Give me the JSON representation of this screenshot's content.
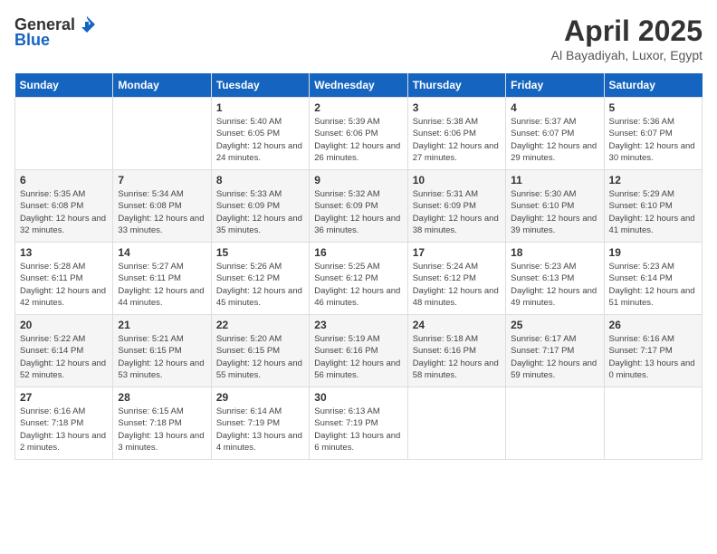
{
  "header": {
    "logo": {
      "line1": "General",
      "line2": "Blue"
    },
    "title": "April 2025",
    "subtitle": "Al Bayadiyah, Luxor, Egypt"
  },
  "days_of_week": [
    "Sunday",
    "Monday",
    "Tuesday",
    "Wednesday",
    "Thursday",
    "Friday",
    "Saturday"
  ],
  "weeks": [
    [
      {
        "day": "",
        "info": ""
      },
      {
        "day": "",
        "info": ""
      },
      {
        "day": "1",
        "info": "Sunrise: 5:40 AM\nSunset: 6:05 PM\nDaylight: 12 hours and 24 minutes."
      },
      {
        "day": "2",
        "info": "Sunrise: 5:39 AM\nSunset: 6:06 PM\nDaylight: 12 hours and 26 minutes."
      },
      {
        "day": "3",
        "info": "Sunrise: 5:38 AM\nSunset: 6:06 PM\nDaylight: 12 hours and 27 minutes."
      },
      {
        "day": "4",
        "info": "Sunrise: 5:37 AM\nSunset: 6:07 PM\nDaylight: 12 hours and 29 minutes."
      },
      {
        "day": "5",
        "info": "Sunrise: 5:36 AM\nSunset: 6:07 PM\nDaylight: 12 hours and 30 minutes."
      }
    ],
    [
      {
        "day": "6",
        "info": "Sunrise: 5:35 AM\nSunset: 6:08 PM\nDaylight: 12 hours and 32 minutes."
      },
      {
        "day": "7",
        "info": "Sunrise: 5:34 AM\nSunset: 6:08 PM\nDaylight: 12 hours and 33 minutes."
      },
      {
        "day": "8",
        "info": "Sunrise: 5:33 AM\nSunset: 6:09 PM\nDaylight: 12 hours and 35 minutes."
      },
      {
        "day": "9",
        "info": "Sunrise: 5:32 AM\nSunset: 6:09 PM\nDaylight: 12 hours and 36 minutes."
      },
      {
        "day": "10",
        "info": "Sunrise: 5:31 AM\nSunset: 6:09 PM\nDaylight: 12 hours and 38 minutes."
      },
      {
        "day": "11",
        "info": "Sunrise: 5:30 AM\nSunset: 6:10 PM\nDaylight: 12 hours and 39 minutes."
      },
      {
        "day": "12",
        "info": "Sunrise: 5:29 AM\nSunset: 6:10 PM\nDaylight: 12 hours and 41 minutes."
      }
    ],
    [
      {
        "day": "13",
        "info": "Sunrise: 5:28 AM\nSunset: 6:11 PM\nDaylight: 12 hours and 42 minutes."
      },
      {
        "day": "14",
        "info": "Sunrise: 5:27 AM\nSunset: 6:11 PM\nDaylight: 12 hours and 44 minutes."
      },
      {
        "day": "15",
        "info": "Sunrise: 5:26 AM\nSunset: 6:12 PM\nDaylight: 12 hours and 45 minutes."
      },
      {
        "day": "16",
        "info": "Sunrise: 5:25 AM\nSunset: 6:12 PM\nDaylight: 12 hours and 46 minutes."
      },
      {
        "day": "17",
        "info": "Sunrise: 5:24 AM\nSunset: 6:12 PM\nDaylight: 12 hours and 48 minutes."
      },
      {
        "day": "18",
        "info": "Sunrise: 5:23 AM\nSunset: 6:13 PM\nDaylight: 12 hours and 49 minutes."
      },
      {
        "day": "19",
        "info": "Sunrise: 5:23 AM\nSunset: 6:14 PM\nDaylight: 12 hours and 51 minutes."
      }
    ],
    [
      {
        "day": "20",
        "info": "Sunrise: 5:22 AM\nSunset: 6:14 PM\nDaylight: 12 hours and 52 minutes."
      },
      {
        "day": "21",
        "info": "Sunrise: 5:21 AM\nSunset: 6:15 PM\nDaylight: 12 hours and 53 minutes."
      },
      {
        "day": "22",
        "info": "Sunrise: 5:20 AM\nSunset: 6:15 PM\nDaylight: 12 hours and 55 minutes."
      },
      {
        "day": "23",
        "info": "Sunrise: 5:19 AM\nSunset: 6:16 PM\nDaylight: 12 hours and 56 minutes."
      },
      {
        "day": "24",
        "info": "Sunrise: 5:18 AM\nSunset: 6:16 PM\nDaylight: 12 hours and 58 minutes."
      },
      {
        "day": "25",
        "info": "Sunrise: 6:17 AM\nSunset: 7:17 PM\nDaylight: 12 hours and 59 minutes."
      },
      {
        "day": "26",
        "info": "Sunrise: 6:16 AM\nSunset: 7:17 PM\nDaylight: 13 hours and 0 minutes."
      }
    ],
    [
      {
        "day": "27",
        "info": "Sunrise: 6:16 AM\nSunset: 7:18 PM\nDaylight: 13 hours and 2 minutes."
      },
      {
        "day": "28",
        "info": "Sunrise: 6:15 AM\nSunset: 7:18 PM\nDaylight: 13 hours and 3 minutes."
      },
      {
        "day": "29",
        "info": "Sunrise: 6:14 AM\nSunset: 7:19 PM\nDaylight: 13 hours and 4 minutes."
      },
      {
        "day": "30",
        "info": "Sunrise: 6:13 AM\nSunset: 7:19 PM\nDaylight: 13 hours and 6 minutes."
      },
      {
        "day": "",
        "info": ""
      },
      {
        "day": "",
        "info": ""
      },
      {
        "day": "",
        "info": ""
      }
    ]
  ]
}
